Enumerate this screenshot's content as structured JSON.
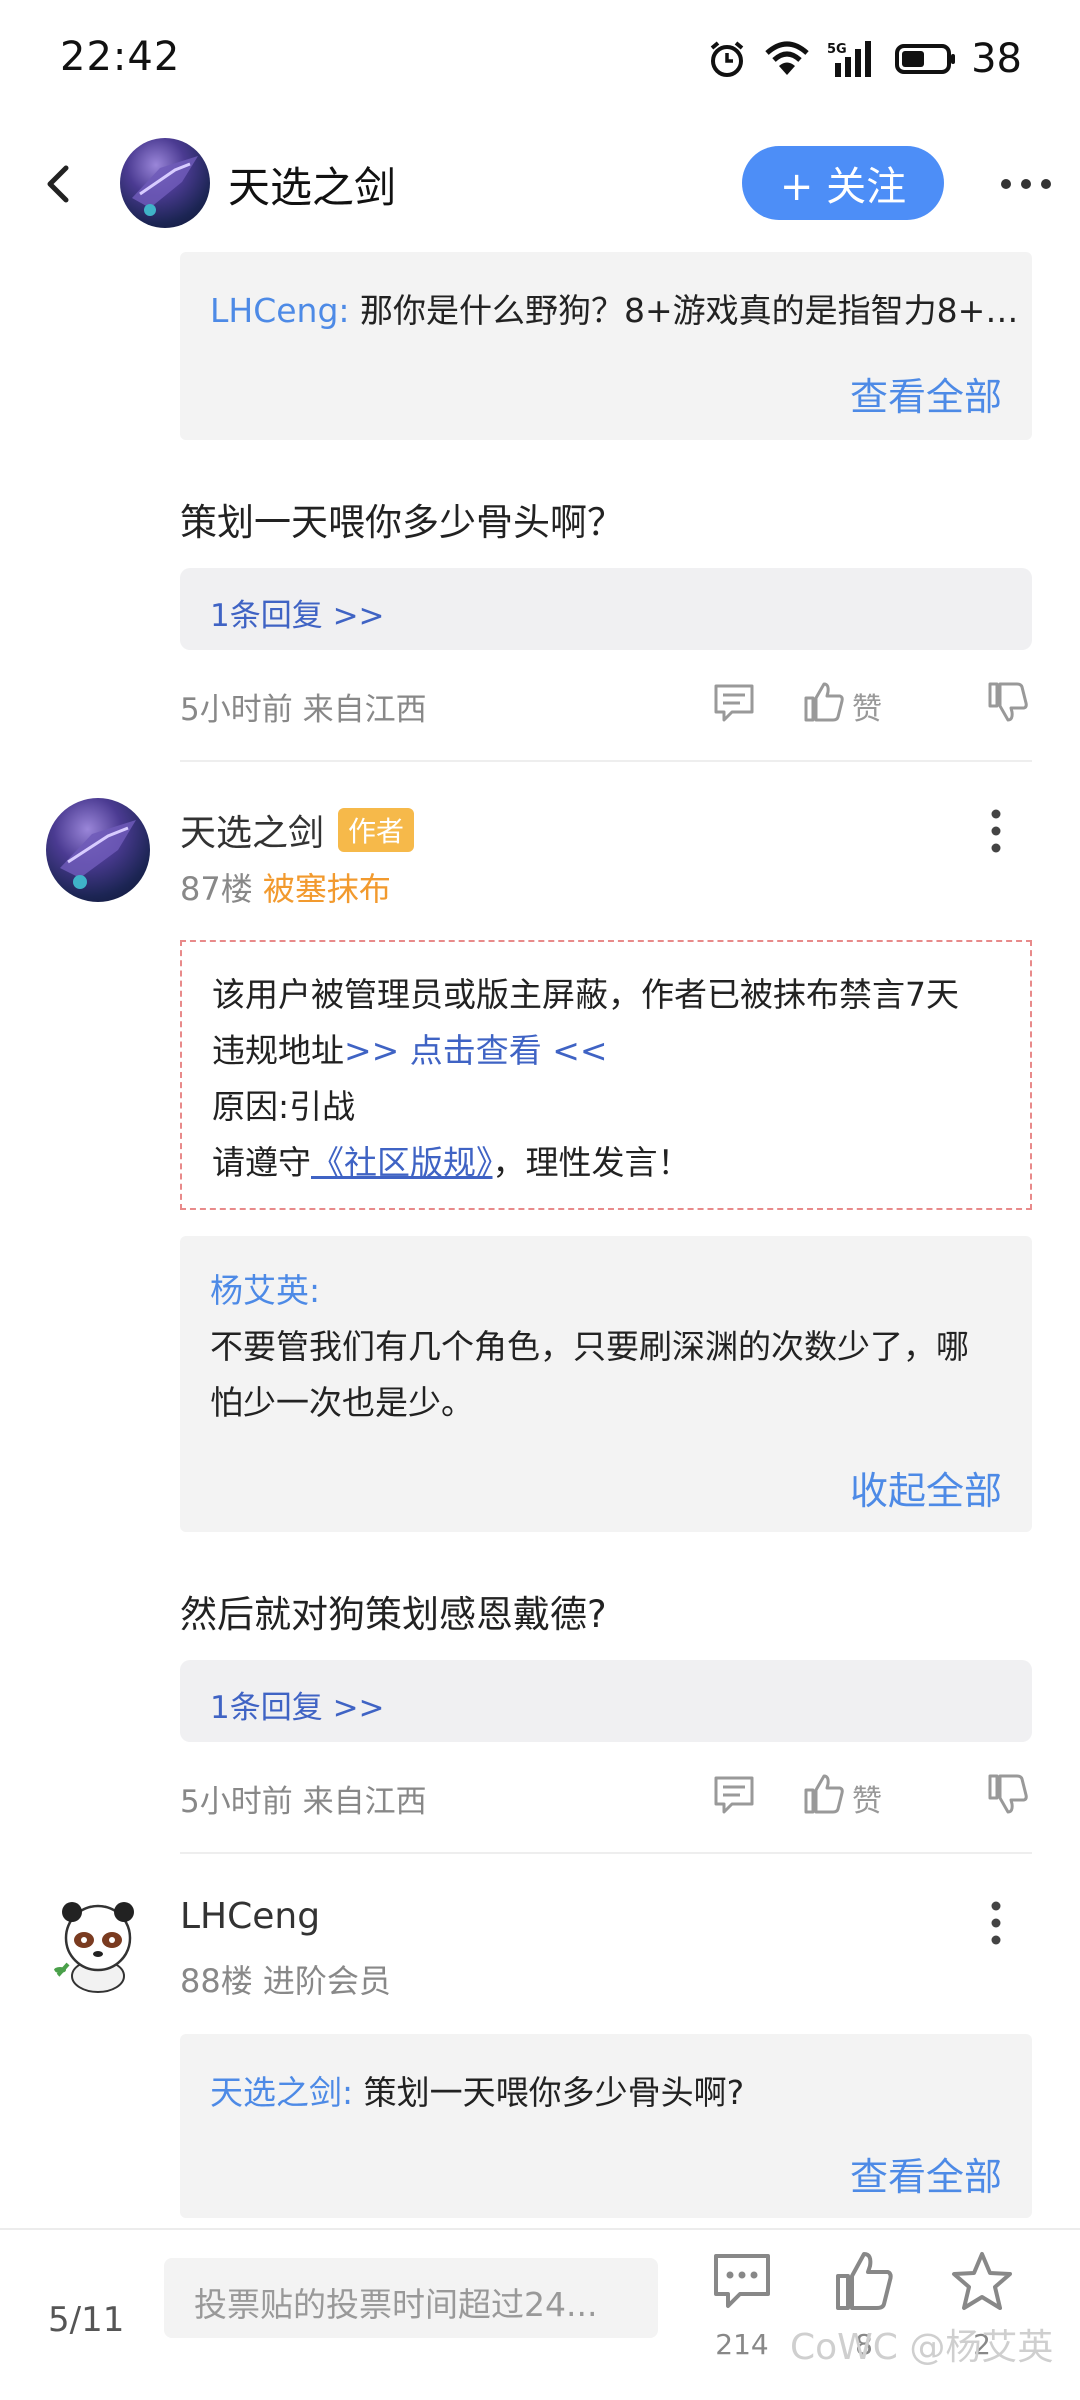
{
  "status_bar": {
    "time": "22:42",
    "network": "5G",
    "battery": "38"
  },
  "header": {
    "title": "天选之剑",
    "follow_label": "+ 关注"
  },
  "top_quote": {
    "author": "LHCeng:",
    "text": "那你是什么野狗？8+游戏真的是指智力8+…",
    "see_all": "查看全部"
  },
  "post1": {
    "body": "策划一天喂你多少骨头啊？",
    "reply_link": "1条回复 >>",
    "meta": "5小时前 来自江西",
    "like_label": "赞"
  },
  "post2": {
    "user": "天选之剑",
    "author_tag": "作者",
    "floor": "87楼",
    "status": "被塞抹布",
    "ban_notice": {
      "line1": "该用户被管理员或版主屏蔽，作者已被抹布禁言7天",
      "line2_prefix": "违规地址",
      "line2_link": ">> 点击查看 <<",
      "line3": "原因:引战",
      "line4_prefix": "请遵守",
      "line4_link": "《社区版规》",
      "line4_suffix": "，理性发言！"
    },
    "quote_author": "杨艾英:",
    "quote_line1": "不要管我们有几个角色，只要刷深渊的次数少了，哪",
    "quote_line2": "怕少一次也是少。",
    "collapse_label": "收起全部",
    "body": "然后就对狗策划感恩戴德?",
    "reply_link": "1条回复 >>",
    "meta": "5小时前 来自江西",
    "like_label": "赞"
  },
  "post3": {
    "user": "LHCeng",
    "floor_line": "88楼 进阶会员",
    "quote_author": "天选之剑:",
    "quote_text": "策划一天喂你多少骨头啊?",
    "see_all": "查看全部"
  },
  "bottom_bar": {
    "page": "5/11",
    "input_placeholder": "投票贴的投票时间超过24...",
    "comment_count": "214",
    "like_count": "8",
    "fav_count": "2",
    "watermark": "CoWC @杨艾英"
  },
  "colors": {
    "accent": "#4d8ef7",
    "link": "#4d8ae6",
    "tag": "#f6b94a",
    "status_orange": "#f29a2e",
    "ban_border": "#e88a8a"
  }
}
